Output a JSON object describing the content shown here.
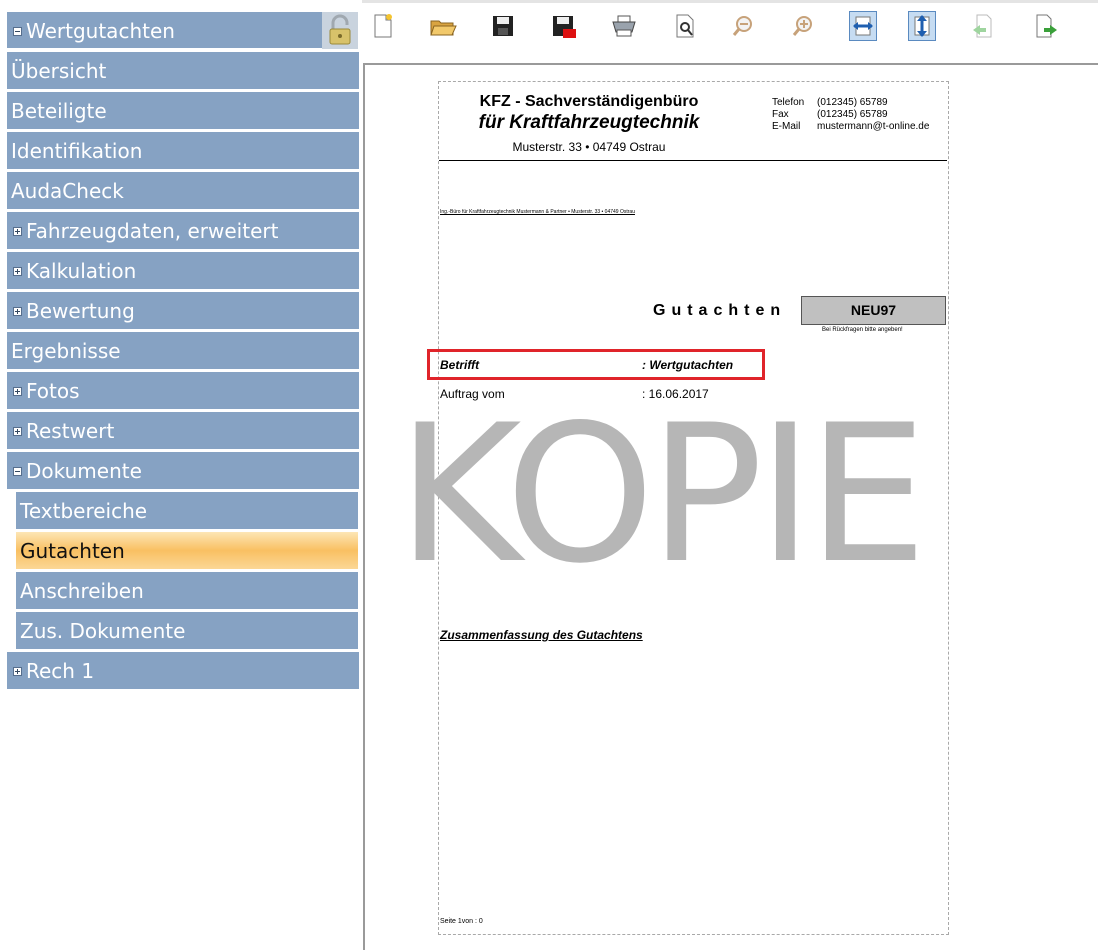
{
  "nav": {
    "items": [
      {
        "label": "Wertgutachten",
        "expander": "minus",
        "indent": 0
      },
      {
        "label": "Übersicht",
        "expander": "none",
        "indent": 0
      },
      {
        "label": "Beteiligte",
        "expander": "none",
        "indent": 0
      },
      {
        "label": "Identifikation",
        "expander": "none",
        "indent": 0
      },
      {
        "label": "AudaCheck",
        "expander": "none",
        "indent": 0
      },
      {
        "label": "Fahrzeugdaten, erweitert",
        "expander": "plus",
        "indent": 0
      },
      {
        "label": "Kalkulation",
        "expander": "plus",
        "indent": 0
      },
      {
        "label": "Bewertung",
        "expander": "plus",
        "indent": 0
      },
      {
        "label": "Ergebnisse",
        "expander": "none",
        "indent": 0
      },
      {
        "label": "Fotos",
        "expander": "plus",
        "indent": 0
      },
      {
        "label": "Restwert",
        "expander": "plus",
        "indent": 0
      },
      {
        "label": "Dokumente",
        "expander": "minus",
        "indent": 0
      },
      {
        "label": "Textbereiche",
        "expander": "none",
        "indent": 1
      },
      {
        "label": "Gutachten",
        "expander": "none",
        "indent": 1,
        "selected": true
      },
      {
        "label": "Anschreiben",
        "expander": "none",
        "indent": 1
      },
      {
        "label": "Zus. Dokumente",
        "expander": "none",
        "indent": 1
      },
      {
        "label": "Rech 1",
        "expander": "plus",
        "indent": 0
      }
    ],
    "lock_icon": "padlock-icon"
  },
  "toolbar": {
    "icons": [
      "new-document-icon",
      "open-folder-icon",
      "save-icon",
      "save-pdf-icon",
      "print-icon",
      "page-preview-icon",
      "zoom-out-icon",
      "zoom-in-icon",
      "fit-width-icon",
      "fit-height-icon",
      "previous-page-icon",
      "next-page-icon"
    ],
    "active": [
      "fit-width-icon",
      "fit-height-icon"
    ]
  },
  "document": {
    "header": {
      "line1": "KFZ - Sachverständigenbüro",
      "line2": "für Kraftfahrzeugtechnik",
      "address": "Musterstr. 33 • 04749 Ostrau"
    },
    "contact": [
      {
        "label": "Telefon",
        "value": "(012345) 65789"
      },
      {
        "label": "Fax",
        "value": "(012345) 65789"
      },
      {
        "label": "E-Mail",
        "value": "mustermann@t-online.de"
      }
    ],
    "sender_line": "Ing.-Büro für Kraftfahrzeugtechnik Mustermann & Partner • Musterstr. 33 • 04749 Ostrau",
    "doc_title": "Gutachten",
    "reference": "NEU97",
    "reference_note": "Bei Rückfragen bitte angeben!",
    "subject_label": "Betrifft",
    "subject_value": ": Wertgutachten",
    "order_label": "Auftrag vom",
    "order_value": ":  16.06.2017",
    "watermark": "KOPIE",
    "summary_heading": "Zusammenfassung des Gutachtens",
    "page_footer": "Seite 1von : 0"
  },
  "colors": {
    "nav_bg": "#86a2c3",
    "selected_bg": "#f9c062",
    "highlight": "#e0242a",
    "watermark": "#b6b6b6"
  }
}
